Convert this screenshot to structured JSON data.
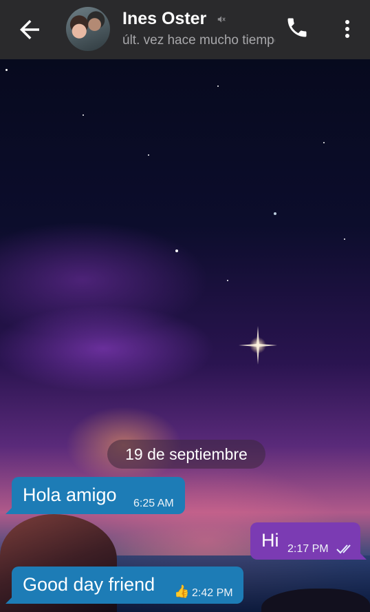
{
  "header": {
    "contact_name": "Ines Oster",
    "last_seen": "últ. vez hace mucho tiempo",
    "icons": {
      "back": "arrow-left-icon",
      "mute": "muted-speaker-icon",
      "call": "phone-icon",
      "menu": "more-vertical-icon"
    }
  },
  "chat": {
    "date_separator": "19 de septiembre",
    "messages": [
      {
        "direction": "incoming",
        "text": "Hola amigo",
        "time": "6:25 AM"
      },
      {
        "direction": "outgoing",
        "text": "Hi",
        "time": "2:17 PM",
        "status": "read"
      },
      {
        "direction": "incoming",
        "text": "Good day friend",
        "emoji": "👍",
        "time": "2:42 PM"
      }
    ]
  },
  "colors": {
    "header_bg": "#2a2a2c",
    "incoming_bubble": "#1d7cb6",
    "outgoing_bubble": "#7b3bb3"
  }
}
